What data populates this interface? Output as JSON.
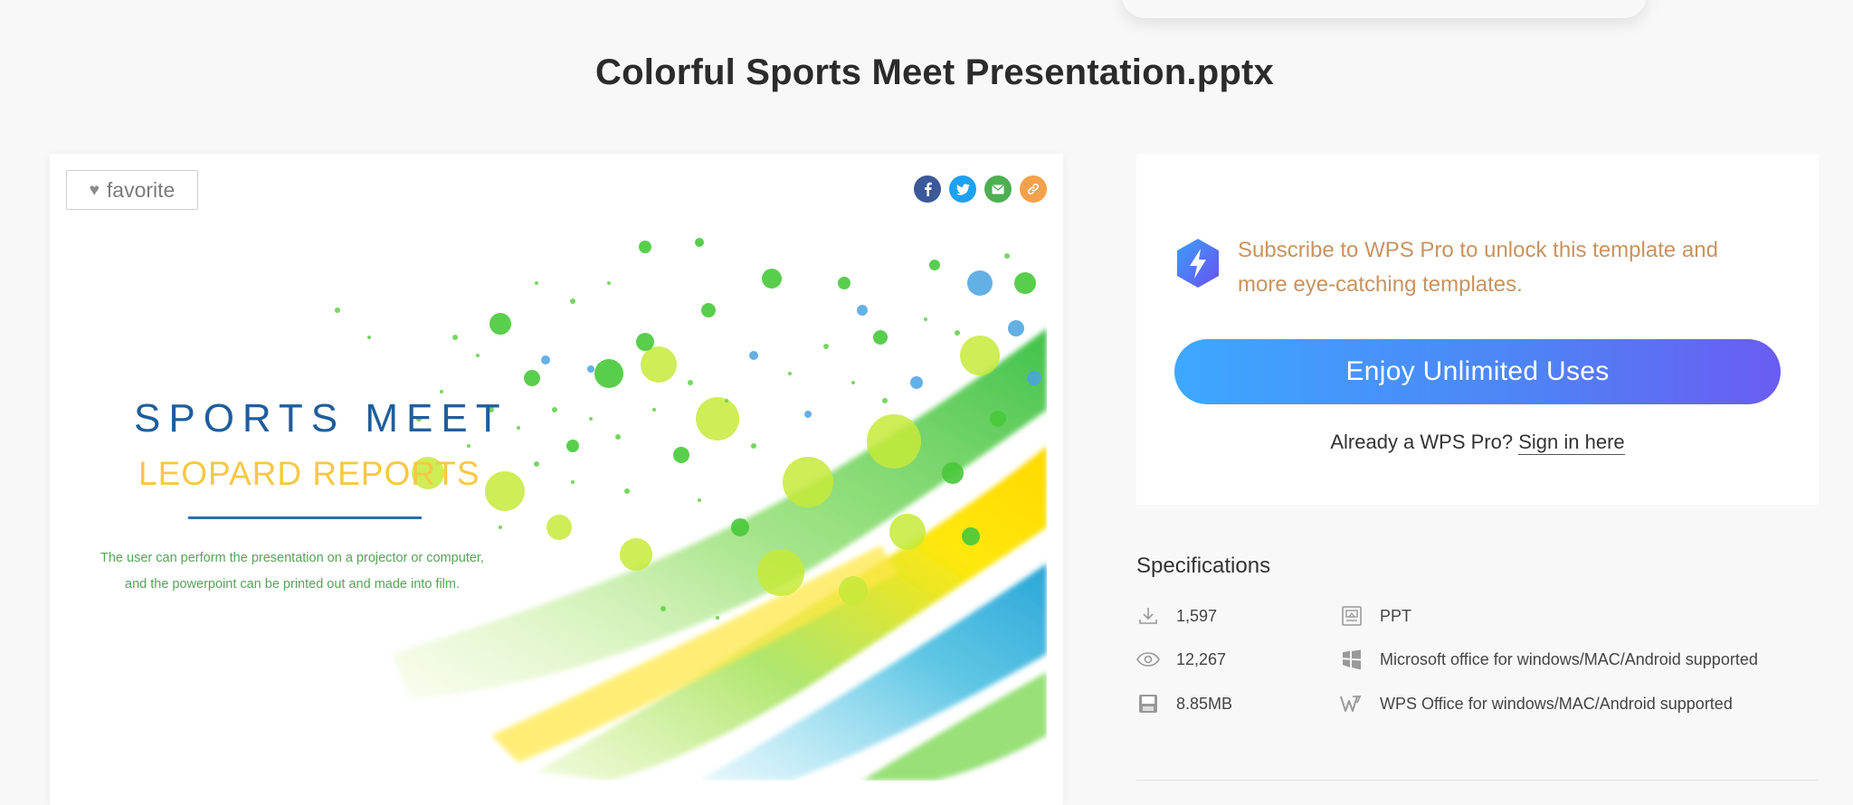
{
  "page": {
    "title": "Colorful Sports Meet Presentation.pptx"
  },
  "preview": {
    "favorite_label": "favorite",
    "share": [
      {
        "name": "facebook",
        "glyph": "f",
        "color": "#3b5998"
      },
      {
        "name": "twitter",
        "glyph": "t",
        "color": "#1da1f2"
      },
      {
        "name": "email",
        "glyph": "✉",
        "color": "#4caf50"
      },
      {
        "name": "link",
        "glyph": "🔗",
        "color": "#f5a14a"
      }
    ],
    "slide": {
      "title": "SPORTS MEET",
      "subtitle": "LEOPARD REPORTS",
      "desc_line1": "The user can perform the presentation on a projector or computer,",
      "desc_line2": "and the powerpoint can be printed out and made into film."
    }
  },
  "subscribe": {
    "message": "Subscribe to WPS Pro to unlock this template and more eye-catching templates.",
    "cta_label": "Enjoy Unlimited Uses",
    "already_text": "Already a WPS Pro?",
    "signin_label": "Sign in here"
  },
  "specs": {
    "title": "Specifications",
    "downloads": "1,597",
    "views": "12,267",
    "size": "8.85MB",
    "format": "PPT",
    "ms_support": "Microsoft office for windows/MAC/Android supported",
    "wps_support": "WPS Office for windows/MAC/Android supported"
  },
  "colors": {
    "accent_gradient_start": "#3da8ff",
    "accent_gradient_end": "#6a5cf2",
    "subscribe_text": "#c8935e",
    "slide_title": "#1f5e9c",
    "slide_subtitle": "#f6c844"
  },
  "icons": [
    "heart-icon",
    "facebook-icon",
    "twitter-icon",
    "email-icon",
    "link-icon",
    "bolt-icon",
    "download-icon",
    "eye-icon",
    "disk-icon",
    "ppt-file-icon",
    "windows-icon",
    "wps-icon"
  ]
}
